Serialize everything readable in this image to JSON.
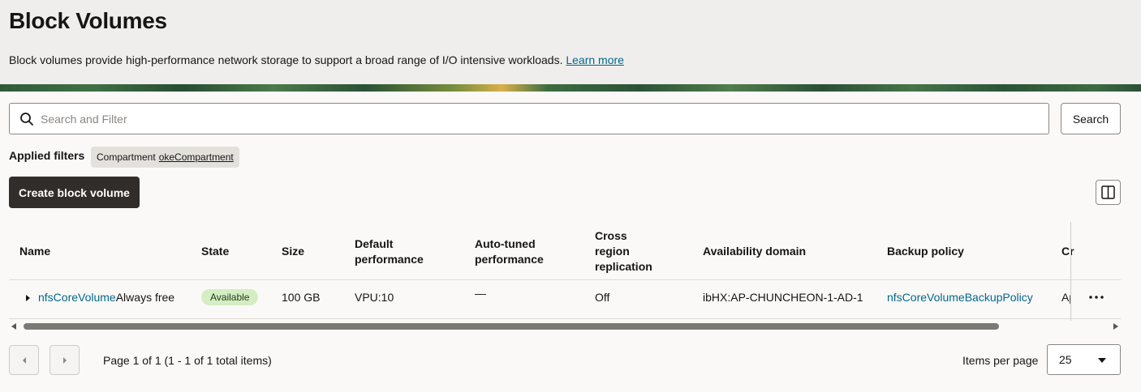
{
  "page": {
    "title": "Block Volumes",
    "description": "Block volumes provide high-performance network storage to support a broad range of I/O intensive workloads.",
    "learn_more": "Learn more"
  },
  "search": {
    "placeholder": "Search and Filter",
    "button_label": "Search"
  },
  "filters": {
    "applied_label": "Applied filters",
    "chip_key": "Compartment",
    "chip_value": "okeCompartment"
  },
  "toolbar": {
    "create_label": "Create block volume"
  },
  "table": {
    "headers": {
      "name": "Name",
      "state": "State",
      "size": "Size",
      "default_perf_1": "Default",
      "default_perf_2": "performance",
      "autotuned_1": "Auto-tuned",
      "autotuned_2": "performance",
      "cross_1": "Cross",
      "cross_2": "region",
      "cross_3": "replication",
      "ad": "Availability domain",
      "backup": "Backup policy",
      "created_partial": "Cr"
    },
    "rows": [
      {
        "name": "nfsCoreVolume",
        "tag": "Always free",
        "state": "Available",
        "size": "100 GB",
        "default_perf": "VPU:10",
        "autotuned": "—",
        "cross_region": "Off",
        "ad": "ibHX:AP-CHUNCHEON-1-AD-1",
        "backup_policy": "nfsCoreVolumeBackupPolicy",
        "created_partial": "Ap"
      }
    ]
  },
  "pagination": {
    "info": "Page 1 of 1 (1 - 1 of 1 total items)",
    "items_per_page_label": "Items per page",
    "items_per_page": "25"
  },
  "colors": {
    "link": "#00688c",
    "primary_button": "#312d2a",
    "badge_available": "#d5edc2"
  }
}
